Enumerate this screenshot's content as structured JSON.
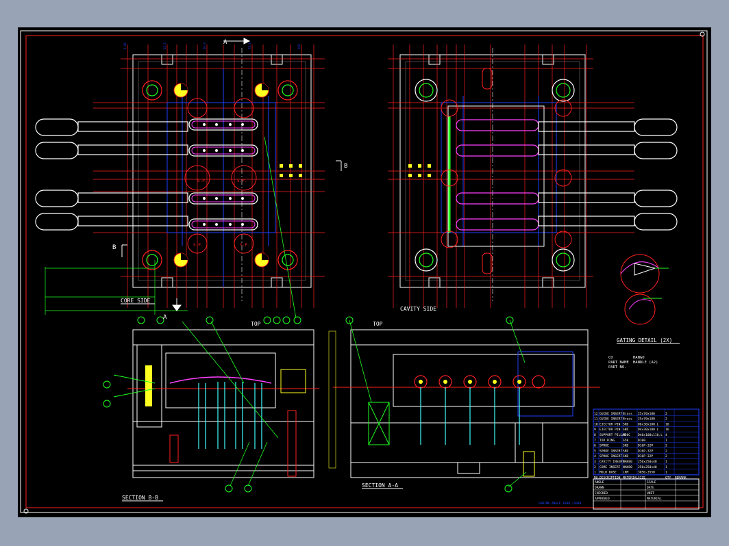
{
  "labels": {
    "core_side": "CORE SIDE",
    "cavity_side": "CAVITY SIDE",
    "section_bb": "SECTION B-B",
    "section_aa": "SECTION A-A",
    "top_left": "TOP",
    "top_right": "TOP",
    "gating_detail": "GATING DETAIL (2X)",
    "section_mark_a": "A",
    "section_mark_a2": "A",
    "section_mark_b": "B",
    "section_mark_b2": "B",
    "shrink_note": "SHRINK ANGLE 1000 /1000"
  },
  "part_info": {
    "co_label": "CO",
    "co_value": "HANGO",
    "part_name_label": "PART NAME",
    "part_name_value": "HANDLE (A2)",
    "part_no_label": "PART NO."
  },
  "sprue_labels": {
    "sp1": "S.P.",
    "sp2": "S.P.",
    "sp3": "S.P.",
    "sp4": "S.P."
  },
  "bom": {
    "rows": [
      [
        "12",
        "GUIDE INSERT",
        "Brass",
        "25x70x180",
        "2",
        ""
      ],
      [
        "11",
        "GUIDE INSERT",
        "Brass",
        "25x70x180",
        "2",
        ""
      ],
      [
        "10",
        "EJECTOR PIN",
        "SKD",
        "D6x30x180.L",
        "16",
        ""
      ],
      [
        "9",
        "EJECTOR PIN",
        "SKD",
        "D4x30x180.L",
        "16",
        ""
      ],
      [
        "8",
        "SUPPORT PILLAR",
        "S50C",
        "D40x100x110.L",
        "4",
        ""
      ],
      [
        "7",
        "TOP RING",
        "S50",
        "D100",
        "1",
        ""
      ],
      [
        "6",
        "SPRUE",
        "SKD",
        "D16P-32P",
        "2",
        ""
      ],
      [
        "5",
        "SPRUE INSERT",
        "SKD",
        "D16P-32P",
        "2",
        ""
      ],
      [
        "4",
        "SPRUE INSERT",
        "SKD",
        "D16P-32P",
        "2",
        ""
      ],
      [
        "3",
        "CAVITY INSERT",
        "NAK80",
        "250x250x40",
        "1",
        ""
      ],
      [
        "2",
        "CORE INSERT",
        "NAK80",
        "250x250x40",
        "1",
        ""
      ],
      [
        "1",
        "MOLD BASE",
        "LKM",
        "3050-3550",
        "1",
        ""
      ]
    ],
    "header": [
      "NO.",
      "DESCRIPTION",
      "MATERIAL",
      "SIZE",
      "QTY",
      "REMARK"
    ]
  },
  "title_block": {
    "lines": [
      "ANGLE",
      "DRAWN",
      "CHECKED",
      "APPROVED",
      "SCALE",
      "DATE",
      "UNIT",
      "MATERIAL"
    ]
  },
  "colors": {
    "background": "#000000",
    "frame": "#ff2020",
    "plate": "#ffffff",
    "guide": "#ff2020",
    "dimension": "#20ff20",
    "cavity": "#ff40ff",
    "cooling": "#2040ff",
    "ejector": "#40ffff",
    "sprue": "#ffff20",
    "screen_bg": "#98a4b6"
  }
}
